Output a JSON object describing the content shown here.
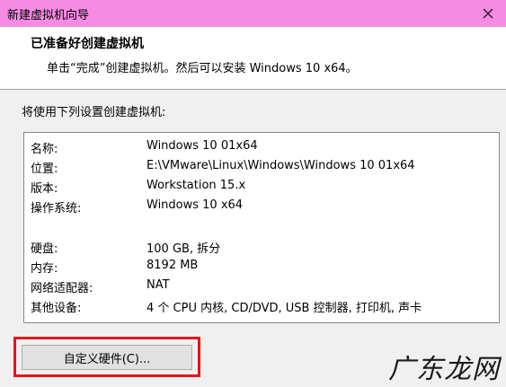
{
  "window": {
    "title": "新建虚拟机向导"
  },
  "header": {
    "title": "已准备好创建虚拟机",
    "subtitle": "单击“完成”创建虚拟机。然后可以安装 Windows 10 x64。"
  },
  "intro": "将使用下列设置创建虚拟机:",
  "summary": {
    "rows": [
      {
        "key": "名称:",
        "value": "Windows 10 01x64"
      },
      {
        "key": "位置:",
        "value": "E:\\VMware\\Linux\\Windows\\Windows 10 01x64"
      },
      {
        "key": "版本:",
        "value": "Workstation 15.x"
      },
      {
        "key": "操作系统:",
        "value": "Windows 10 x64"
      },
      {
        "key": "硬盘:",
        "value": "100 GB, 拆分"
      },
      {
        "key": "内存:",
        "value": "8192 MB"
      },
      {
        "key": "网络适配器:",
        "value": "NAT"
      },
      {
        "key": "其他设备:",
        "value": "4 个 CPU 内核, CD/DVD, USB 控制器, 打印机, 声卡"
      }
    ]
  },
  "buttons": {
    "customize_label": "自定义硬件(C)..."
  },
  "colors": {
    "titlebar": "#f58be2",
    "highlight": "#e8141c"
  },
  "watermark": "广东龙网"
}
